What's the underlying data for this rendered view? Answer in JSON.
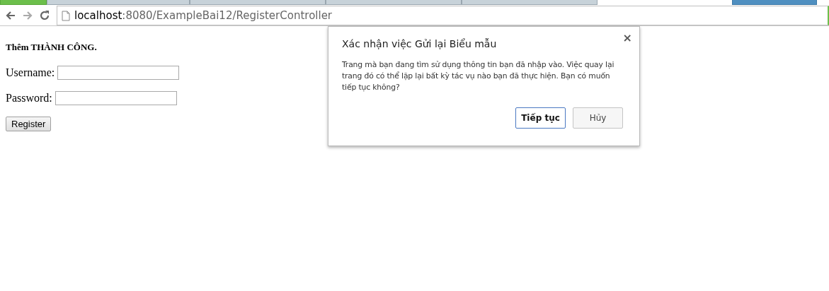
{
  "toolbar": {
    "address_host": "localhost",
    "address_rest": ":8080/ExampleBai12/RegisterController"
  },
  "page": {
    "message": "Thêm THÀNH CÔNG.",
    "fields": [
      {
        "label": "Username:"
      },
      {
        "label": "Password:"
      }
    ],
    "button": "Register"
  },
  "dialog": {
    "title": "Xác nhận việc Gửi lại Biểu mẫu",
    "body": "Trang mà bạn đang tìm sử dụng thông tin bạn đã nhập vào. Việc quay lại trang đó có thể lặp lại bất kỳ tác vụ nào bạn đã thực hiện. Bạn có muốn tiếp tục không?",
    "close": "×",
    "buttons": [
      {
        "label": "Tiếp tục",
        "selected": true
      },
      {
        "label": "Hủy",
        "selected": false
      }
    ]
  }
}
